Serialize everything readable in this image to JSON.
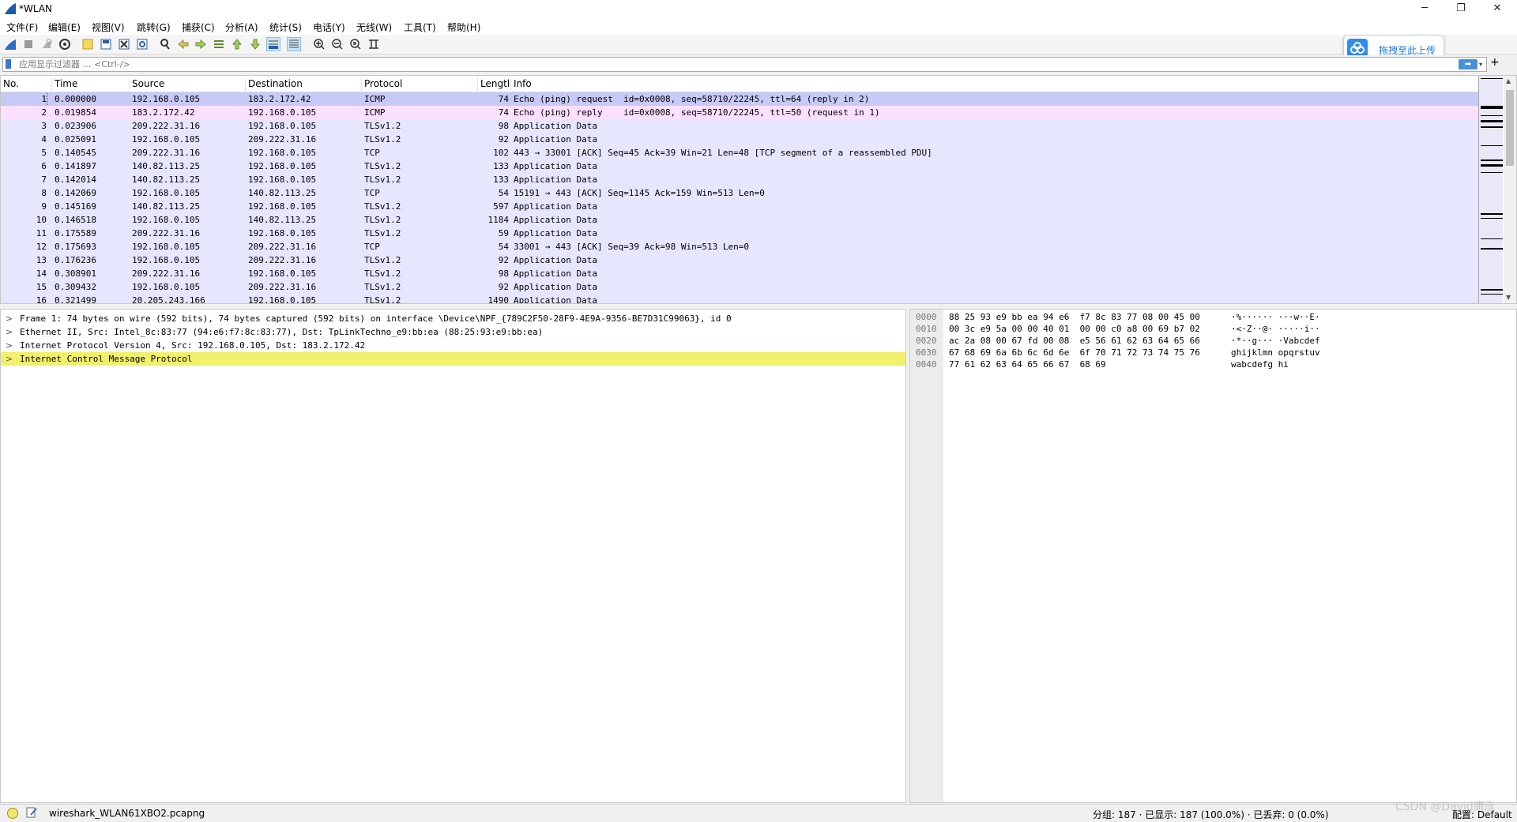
{
  "window": {
    "title": "*WLAN",
    "controls": [
      "─",
      "❐",
      "✕"
    ]
  },
  "menu": [
    "文件(F)",
    "编辑(E)",
    "视图(V)",
    "跳转(G)",
    "捕获(C)",
    "分析(A)",
    "统计(S)",
    "电话(Y)",
    "无线(W)",
    "工具(T)",
    "帮助(H)"
  ],
  "upload_badge": {
    "label": "拖拽至此上传"
  },
  "filter": {
    "placeholder": "应用显示过滤器 … <Ctrl-/>",
    "value": ""
  },
  "packet_list": {
    "columns": [
      "No.",
      "Time",
      "Source",
      "Destination",
      "Protocol",
      "Lengtl",
      "Info"
    ],
    "rows": [
      {
        "no": "1",
        "time": "0.000000",
        "src": "192.168.0.105",
        "dst": "183.2.172.42",
        "proto": "ICMP",
        "len": "74",
        "info": "Echo (ping) request  id=0x0008, seq=58710/22245, ttl=64 (reply in 2)",
        "color": "#c7c9f6",
        "selected": true
      },
      {
        "no": "2",
        "time": "0.019854",
        "src": "183.2.172.42",
        "dst": "192.168.0.105",
        "proto": "ICMP",
        "len": "74",
        "info": "Echo (ping) reply    id=0x0008, seq=58710/22245, ttl=50 (request in 1)",
        "color": "#fce0ff"
      },
      {
        "no": "3",
        "time": "0.023906",
        "src": "209.222.31.16",
        "dst": "192.168.0.105",
        "proto": "TLSv1.2",
        "len": "98",
        "info": "Application Data",
        "color": "#e7e6ff"
      },
      {
        "no": "4",
        "time": "0.025091",
        "src": "192.168.0.105",
        "dst": "209.222.31.16",
        "proto": "TLSv1.2",
        "len": "92",
        "info": "Application Data",
        "color": "#e7e6ff"
      },
      {
        "no": "5",
        "time": "0.140545",
        "src": "209.222.31.16",
        "dst": "192.168.0.105",
        "proto": "TCP",
        "len": "102",
        "info": "443 → 33001 [ACK] Seq=45 Ack=39 Win=21 Len=48 [TCP segment of a reassembled PDU]",
        "color": "#e7e6ff"
      },
      {
        "no": "6",
        "time": "0.141897",
        "src": "140.82.113.25",
        "dst": "192.168.0.105",
        "proto": "TLSv1.2",
        "len": "133",
        "info": "Application Data",
        "color": "#e7e6ff"
      },
      {
        "no": "7",
        "time": "0.142014",
        "src": "140.82.113.25",
        "dst": "192.168.0.105",
        "proto": "TLSv1.2",
        "len": "133",
        "info": "Application Data",
        "color": "#e7e6ff"
      },
      {
        "no": "8",
        "time": "0.142069",
        "src": "192.168.0.105",
        "dst": "140.82.113.25",
        "proto": "TCP",
        "len": "54",
        "info": "15191 → 443 [ACK] Seq=1145 Ack=159 Win=513 Len=0",
        "color": "#e7e6ff"
      },
      {
        "no": "9",
        "time": "0.145169",
        "src": "140.82.113.25",
        "dst": "192.168.0.105",
        "proto": "TLSv1.2",
        "len": "597",
        "info": "Application Data",
        "color": "#e7e6ff"
      },
      {
        "no": "10",
        "time": "0.146518",
        "src": "192.168.0.105",
        "dst": "140.82.113.25",
        "proto": "TLSv1.2",
        "len": "1184",
        "info": "Application Data",
        "color": "#e7e6ff"
      },
      {
        "no": "11",
        "time": "0.175589",
        "src": "209.222.31.16",
        "dst": "192.168.0.105",
        "proto": "TLSv1.2",
        "len": "59",
        "info": "Application Data",
        "color": "#e7e6ff"
      },
      {
        "no": "12",
        "time": "0.175693",
        "src": "192.168.0.105",
        "dst": "209.222.31.16",
        "proto": "TCP",
        "len": "54",
        "info": "33001 → 443 [ACK] Seq=39 Ack=98 Win=513 Len=0",
        "color": "#e7e6ff"
      },
      {
        "no": "13",
        "time": "0.176236",
        "src": "192.168.0.105",
        "dst": "209.222.31.16",
        "proto": "TLSv1.2",
        "len": "92",
        "info": "Application Data",
        "color": "#e7e6ff"
      },
      {
        "no": "14",
        "time": "0.308901",
        "src": "209.222.31.16",
        "dst": "192.168.0.105",
        "proto": "TLSv1.2",
        "len": "98",
        "info": "Application Data",
        "color": "#e7e6ff"
      },
      {
        "no": "15",
        "time": "0.309432",
        "src": "192.168.0.105",
        "dst": "209.222.31.16",
        "proto": "TLSv1.2",
        "len": "92",
        "info": "Application Data",
        "color": "#e7e6ff"
      },
      {
        "no": "16",
        "time": "0.321499",
        "src": "20.205.243.166",
        "dst": "192.168.0.105",
        "proto": "TLSv1.2",
        "len": "1490",
        "info": "Application Data",
        "color": "#e7e6ff"
      }
    ]
  },
  "details": {
    "rows": [
      {
        "text": "Frame 1: 74 bytes on wire (592 bits), 74 bytes captured (592 bits) on interface \\Device\\NPF_{789C2F50-28F9-4E9A-9356-BE7D31C99063}, id 0",
        "highlight": false
      },
      {
        "text": "Ethernet II, Src: Intel_8c:83:77 (94:e6:f7:8c:83:77), Dst: TpLinkTechno_e9:bb:ea (88:25:93:e9:bb:ea)",
        "highlight": false
      },
      {
        "text": "Internet Protocol Version 4, Src: 192.168.0.105, Dst: 183.2.172.42",
        "highlight": false
      },
      {
        "text": "Internet Control Message Protocol",
        "highlight": true
      }
    ],
    "expander": ">"
  },
  "bytes": {
    "rows": [
      {
        "offset": "0000",
        "hex": "88 25 93 e9 bb ea 94 e6  f7 8c 83 77 08 00 45 00",
        "ascii": "·%······ ···w··E·"
      },
      {
        "offset": "0010",
        "hex": "00 3c e9 5a 00 00 40 01  00 00 c0 a8 00 69 b7 02",
        "ascii": "·<·Z··@· ·····i··"
      },
      {
        "offset": "0020",
        "hex": "ac 2a 08 00 67 fd 00 08  e5 56 61 62 63 64 65 66",
        "ascii": "·*··g··· ·Vabcdef"
      },
      {
        "offset": "0030",
        "hex": "67 68 69 6a 6b 6c 6d 6e  6f 70 71 72 73 74 75 76",
        "ascii": "ghijklmn opqrstuv"
      },
      {
        "offset": "0040",
        "hex": "77 61 62 63 64 65 66 67  68 69",
        "ascii": "wabcdefg hi"
      }
    ]
  },
  "status": {
    "file": "wireshark_WLAN61XBO2.pcapng",
    "stats": "分组: 187 · 已显示: 187 (100.0%) · 已丢弃: 0 (0.0%)",
    "profile": "配置: Default"
  },
  "watermark": "CSDN @David康彦",
  "colors": {
    "selected_row": "#c7c9f6",
    "icmp_reply": "#fce0ff",
    "tcp_default": "#e7e6ff",
    "detail_highlight": "#f1f06c"
  }
}
